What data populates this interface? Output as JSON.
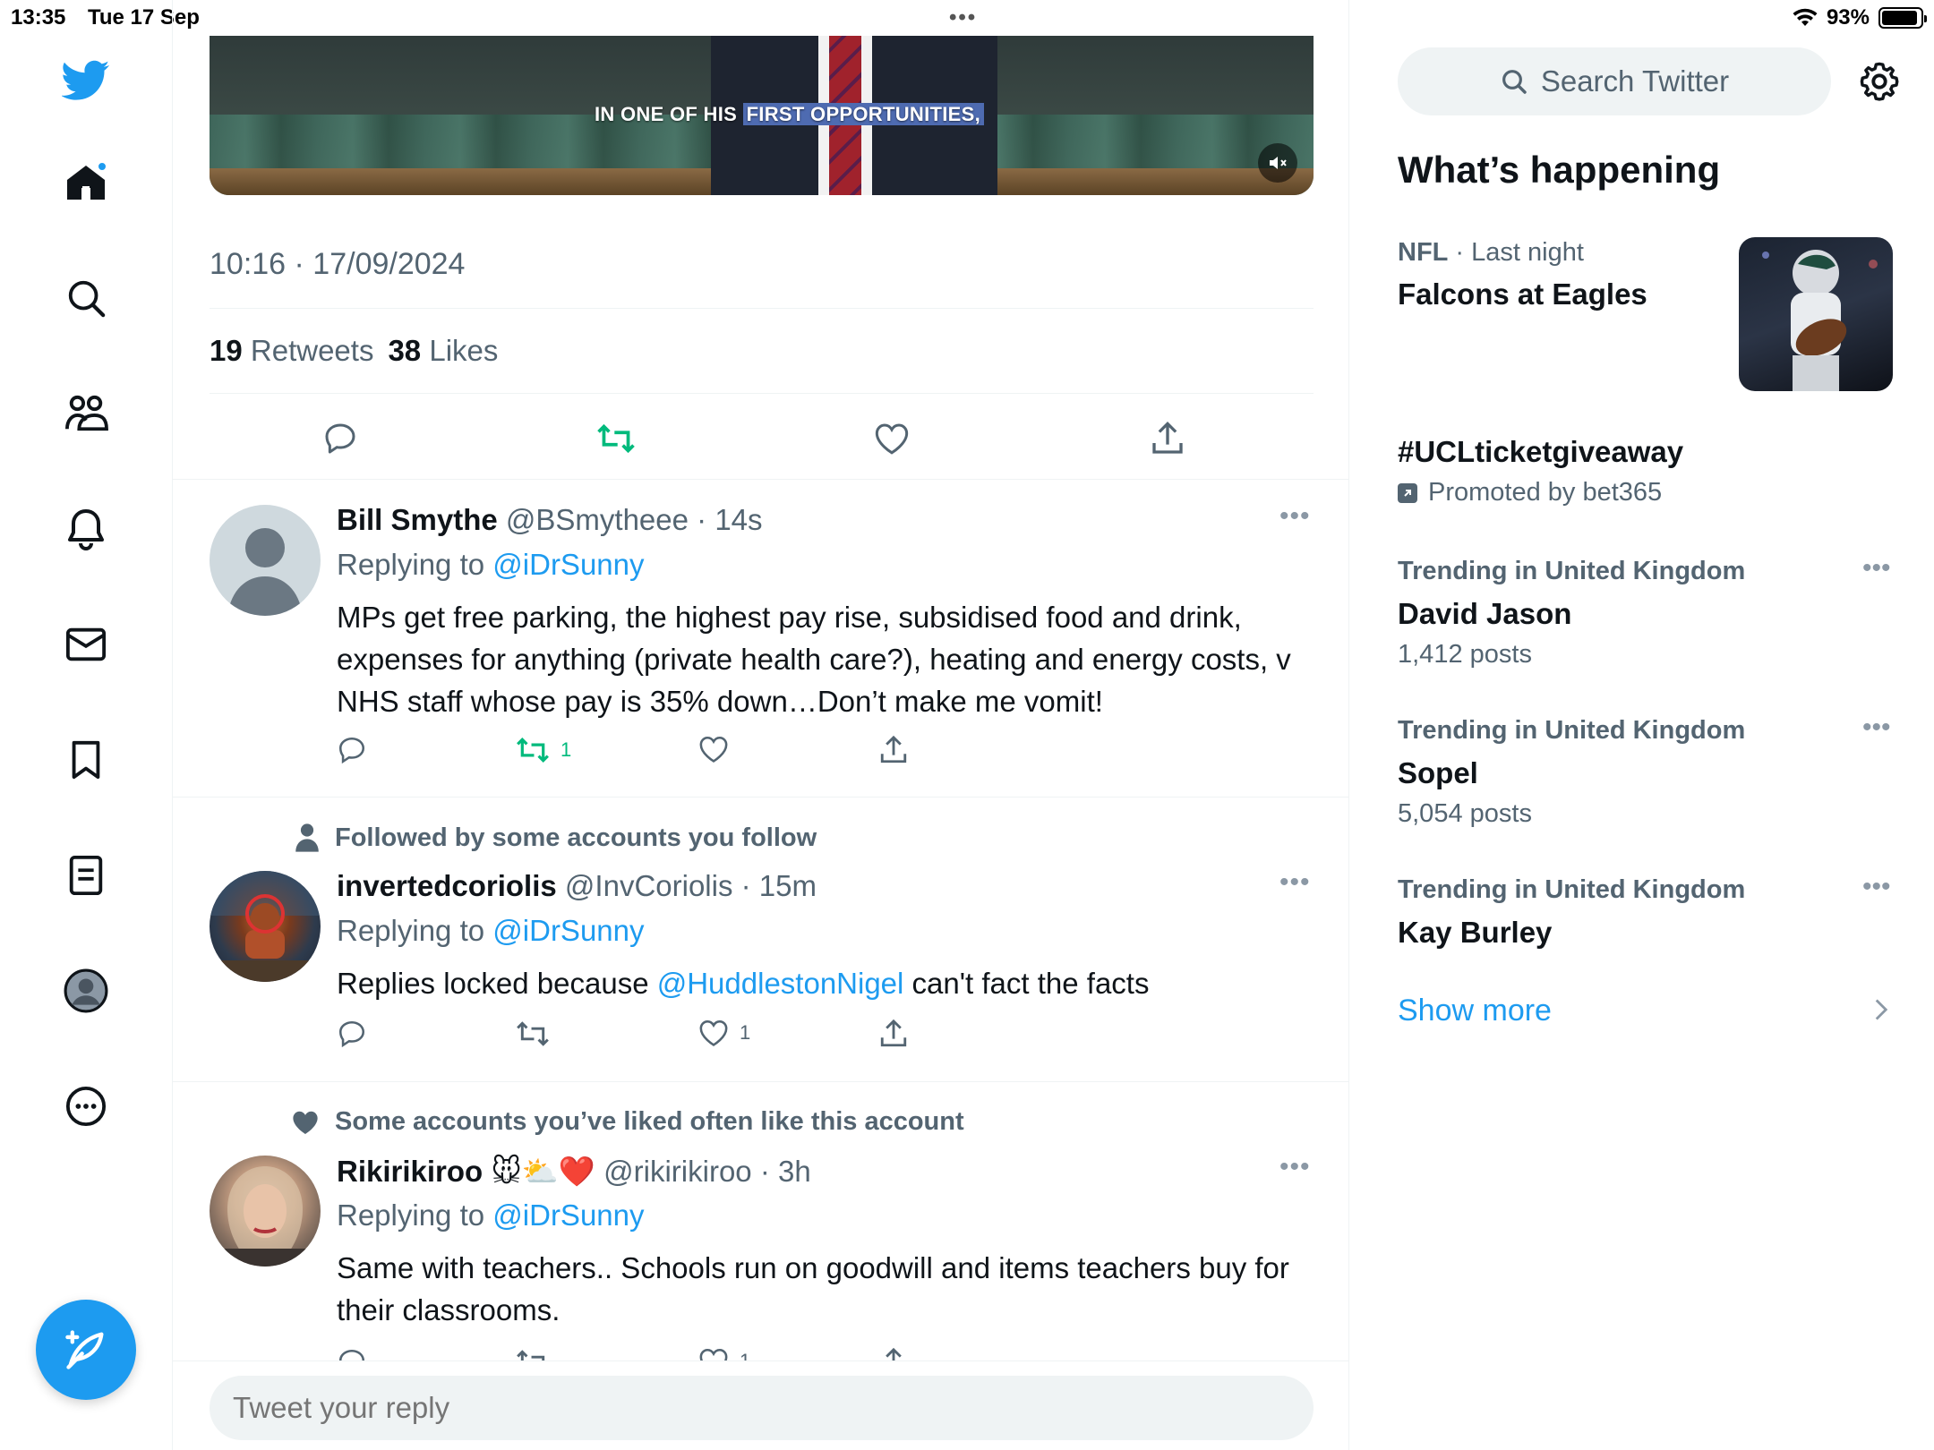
{
  "status_bar": {
    "time": "13:35",
    "date": "Tue 17 Sep",
    "battery": "93%",
    "battery_level": 0.93
  },
  "nav": {
    "items": [
      "home-icon",
      "search-icon",
      "communities-icon",
      "notifications-icon",
      "messages-icon",
      "bookmarks-icon",
      "lists-icon",
      "profile-icon",
      "more-icon"
    ],
    "compose_icon": "compose-tweet-icon",
    "logo_icon": "twitter-bird-icon"
  },
  "tweet": {
    "video_caption_prefix": "IN ONE OF HIS ",
    "video_caption_highlight": "FIRST OPPORTUNITIES,",
    "timestamp": "10:16 · 17/09/2024",
    "retweets_count": "19",
    "retweets_label": "Retweets",
    "likes_count": "38",
    "likes_label": "Likes"
  },
  "replies": [
    {
      "context": "",
      "name": "Bill Smythe",
      "handle": "@BSmytheee",
      "time": "· 14s",
      "replying_label": "Replying to",
      "replying_to": "@iDrSunny",
      "text": "MPs get free parking, the highest pay rise, subsidised food and drink, expenses for anything (private health care?), heating and energy costs, v NHS staff whose pay is 35% down…Don’t make me vomit!",
      "retweets": "1",
      "likes": ""
    },
    {
      "context": "Followed by some accounts you follow",
      "name": "invertedcoriolis",
      "handle": "@InvCoriolis",
      "time": "· 15m",
      "replying_label": "Replying to",
      "replying_to": "@iDrSunny",
      "text_before": "Replies locked because ",
      "text_mention": "@HuddlestonNigel",
      "text_after": " can't fact the facts",
      "retweets": "",
      "likes": "1"
    },
    {
      "context": "Some accounts you’ve liked often like this account",
      "name": "Rikirikiroo 🐭⛅❤️",
      "handle": "@rikirikiroo",
      "time": "· 3h",
      "replying_label": "Replying to",
      "replying_to": "@iDrSunny",
      "text": "Same with teachers.. Schools run on goodwill and items teachers buy for their classrooms.",
      "retweets": "",
      "likes": "1"
    }
  ],
  "reply_box": {
    "placeholder": "Tweet your reply"
  },
  "sidebar": {
    "search_placeholder": "Search Twitter",
    "title": "What’s happening",
    "trends": [
      {
        "category": "NFL",
        "meta": " · Last night",
        "title": "Falcons at Eagles",
        "count": ""
      },
      {
        "category": "",
        "meta": "",
        "title": "#UCLticketgiveaway",
        "promo": "Promoted by bet365",
        "count": ""
      },
      {
        "category": "",
        "meta": "Trending in United Kingdom",
        "title": "David Jason",
        "count": "1,412 posts"
      },
      {
        "category": "",
        "meta": "Trending in United Kingdom",
        "title": "Sopel",
        "count": "5,054 posts"
      },
      {
        "category": "",
        "meta": "Trending in United Kingdom",
        "title": "Kay Burley",
        "count": ""
      }
    ],
    "show_more": "Show more"
  },
  "colors": {
    "accent": "#1d9bf0",
    "retweet_green": "#00ba7c",
    "secondary_text": "#536471",
    "divider": "#eff3f4"
  }
}
